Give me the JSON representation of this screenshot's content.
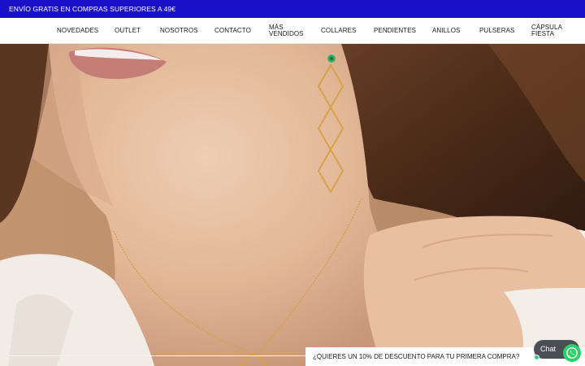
{
  "announcement": {
    "text": "ENVÍO GRATIS EN COMPRAS SUPERIORES A 49€"
  },
  "nav": {
    "items": [
      {
        "label": "NOVEDADES"
      },
      {
        "label": "OUTLET"
      },
      {
        "label": "NOSOTROS"
      },
      {
        "label": "CONTACTO"
      },
      {
        "label_line1": "MÁS",
        "label_line2": "VENDIDOS"
      },
      {
        "label": "COLLARES"
      },
      {
        "label": "PENDIENTES"
      },
      {
        "label": "ANILLOS"
      },
      {
        "label": "PULSERAS"
      },
      {
        "label_line1": "CÁPSULA",
        "label_line2": "FIESTA"
      }
    ]
  },
  "hero": {
    "icon": "hero-photo-woman-earrings-necklace"
  },
  "promo_popup": {
    "text": "¿QUIERES UN 10% DE DESCUENTO PARA TU PRIMERA COMPRA?"
  },
  "chat": {
    "label": "Chat",
    "status_color": "#2ecc71",
    "whatsapp_color": "#25d366",
    "icon": "whatsapp-icon"
  },
  "colors": {
    "announcement_bg": "#1a10c8",
    "jewelry_gold": "#d7a24a"
  }
}
